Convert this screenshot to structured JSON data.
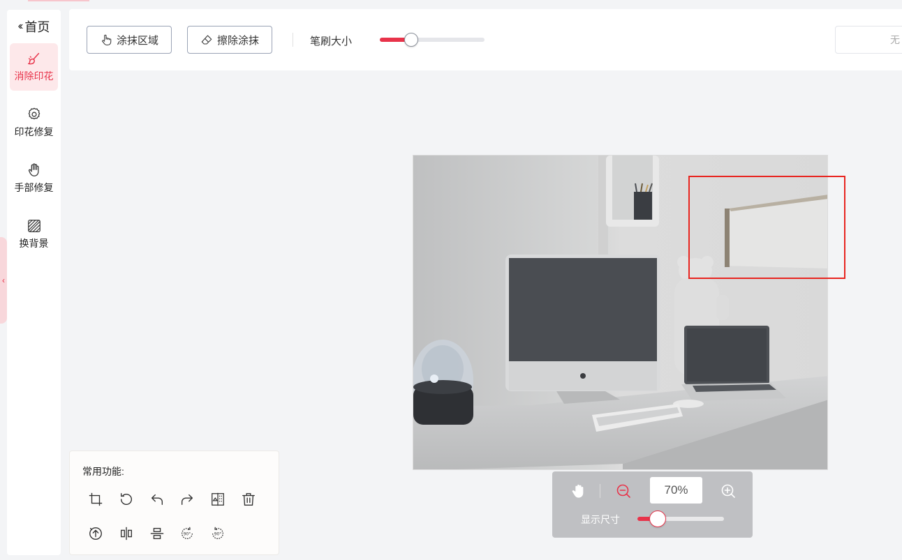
{
  "sidebar": {
    "home_label": "首页",
    "items": [
      {
        "label": "消除印花",
        "icon": "brush-icon",
        "active": true
      },
      {
        "label": "印花修复",
        "icon": "gear-icon",
        "active": false
      },
      {
        "label": "手部修复",
        "icon": "hand-icon",
        "active": false
      },
      {
        "label": "换背景",
        "icon": "hatched-square-icon",
        "active": false
      }
    ]
  },
  "toolbar": {
    "paint_label": "涂抹区域",
    "erase_label": "擦除涂抹",
    "brush_size_label": "笔刷大小",
    "brush_size_fraction": 0.3,
    "right_box_text": "无"
  },
  "canvas": {
    "image_subject": "desk-setup-photo"
  },
  "zoom": {
    "value": "70%",
    "display_size_label": "显示尺寸",
    "display_size_fraction": 0.23
  },
  "functions": {
    "title": "常用功能:",
    "icons": [
      "crop-icon",
      "rotate-icon",
      "undo-icon",
      "redo-icon",
      "compare-icon",
      "delete-icon",
      "upload-icon",
      "flip-horizontal-icon",
      "flip-vertical-icon",
      "rotate-90-cw-icon",
      "rotate-90-ccw-icon"
    ]
  },
  "colors": {
    "accent": "#e8334a",
    "selection": "#e8241f"
  }
}
